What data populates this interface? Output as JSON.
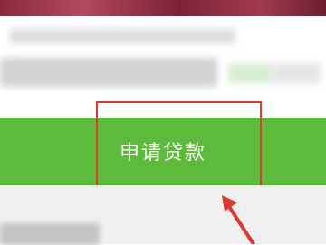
{
  "apply_button": {
    "label": "申请贷款"
  },
  "annotation": {
    "highlight_color": "#e0382c",
    "button_color": "#5dbb3c"
  }
}
